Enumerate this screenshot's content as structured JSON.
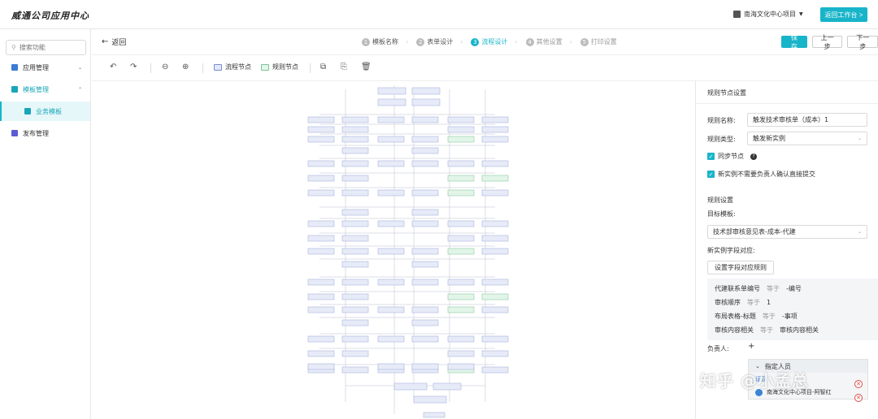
{
  "app": {
    "title": "威通公司应用中心",
    "project": "南海文化中心项目",
    "back_workspace": "返回工作台 >"
  },
  "sidebar": {
    "search_placeholder": "搜索功能",
    "items": [
      {
        "label": "应用管理",
        "color": "#3a7bd5"
      },
      {
        "label": "模板管理",
        "color": "#1aa5b8"
      },
      {
        "label": "业务模板",
        "color": "#1aa5b8"
      },
      {
        "label": "发布管理",
        "color": "#5b5bd6"
      }
    ]
  },
  "header": {
    "back": "返回",
    "steps": [
      {
        "num": "1",
        "label": "模板名称"
      },
      {
        "num": "2",
        "label": "表单设计"
      },
      {
        "num": "3",
        "label": "流程设计"
      },
      {
        "num": "4",
        "label": "其他设置"
      },
      {
        "num": "5",
        "label": "打印设置"
      }
    ],
    "save": "保 存",
    "prev": "上一步",
    "next": "下一步"
  },
  "toolbar": {
    "flow_node": "流程节点",
    "rule_node": "规则节点"
  },
  "panel": {
    "title": "规则节点设置",
    "rule_name_label": "规则名称:",
    "rule_name_value": "触发技术审核单（成本）1",
    "rule_type_label": "规则类型:",
    "rule_type_value": "触发新实例",
    "sync_node": "同步节点",
    "auto_submit": "新实例不需要负责人确认直接提交",
    "rule_settings": "规则设置",
    "target_template_label": "目标模板:",
    "target_template_value": "技术部审核意见表-成本-代建",
    "field_mapping_label": "新实例字段对应:",
    "field_mapping_button": "设置字段对应规则",
    "mappings": [
      {
        "left": "代建联系单编号",
        "op": "等于",
        "right": "-编号"
      },
      {
        "left": "审核顺序",
        "op": "等于",
        "right": "1"
      },
      {
        "left": "布局表格-标题",
        "op": "等于",
        "right": "-事项"
      },
      {
        "left": "审核内容相关",
        "op": "等于",
        "right": "审核内容相关"
      }
    ],
    "owner_label": "负责人:",
    "owner_add": "+",
    "assign_title": "指定人员",
    "assign_person": "南海文化中心项目-阿智红",
    "assign_partial": "证显"
  },
  "watermark": "知乎 @小孟总"
}
